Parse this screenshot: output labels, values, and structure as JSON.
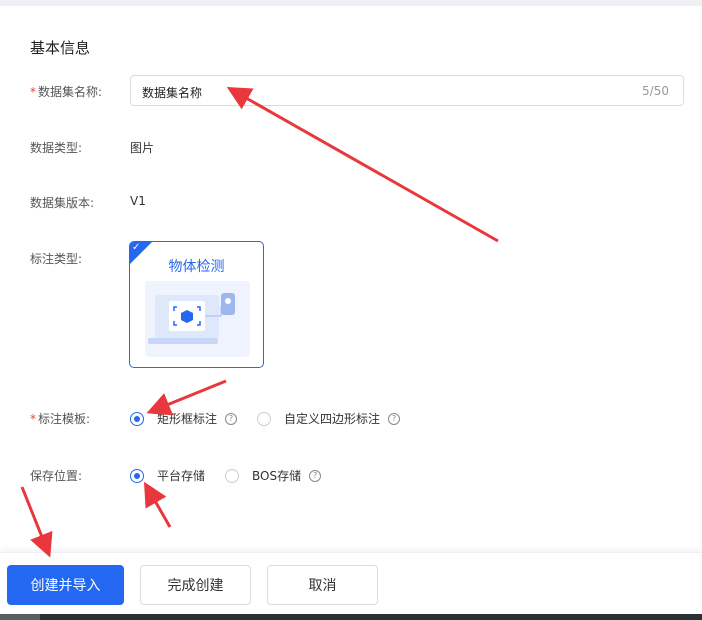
{
  "section": {
    "title": "基本信息"
  },
  "fields": {
    "name": {
      "label": "数据集名称:",
      "value": "数据集名称",
      "counter": "5/50"
    },
    "type": {
      "label": "数据类型:",
      "value": "图片"
    },
    "version": {
      "label": "数据集版本:",
      "value": "V1"
    },
    "annotation_type": {
      "label": "标注类型:",
      "card_title": "物体检测"
    },
    "template": {
      "label": "标注模板:",
      "options": [
        "矩形框标注",
        "自定义四边形标注"
      ],
      "selected": "矩形框标注"
    },
    "storage": {
      "label": "保存位置:",
      "options": [
        "平台存储",
        "BOS存储"
      ],
      "selected": "平台存储"
    }
  },
  "required_mark": "*",
  "help_glyph": "?",
  "check_glyph": "✓",
  "footer": {
    "create_import": "创建并导入",
    "finish": "完成创建",
    "cancel": "取消"
  },
  "colors": {
    "accent": "#2468f2",
    "arrow": "#e8383d",
    "required": "#f0413a"
  }
}
